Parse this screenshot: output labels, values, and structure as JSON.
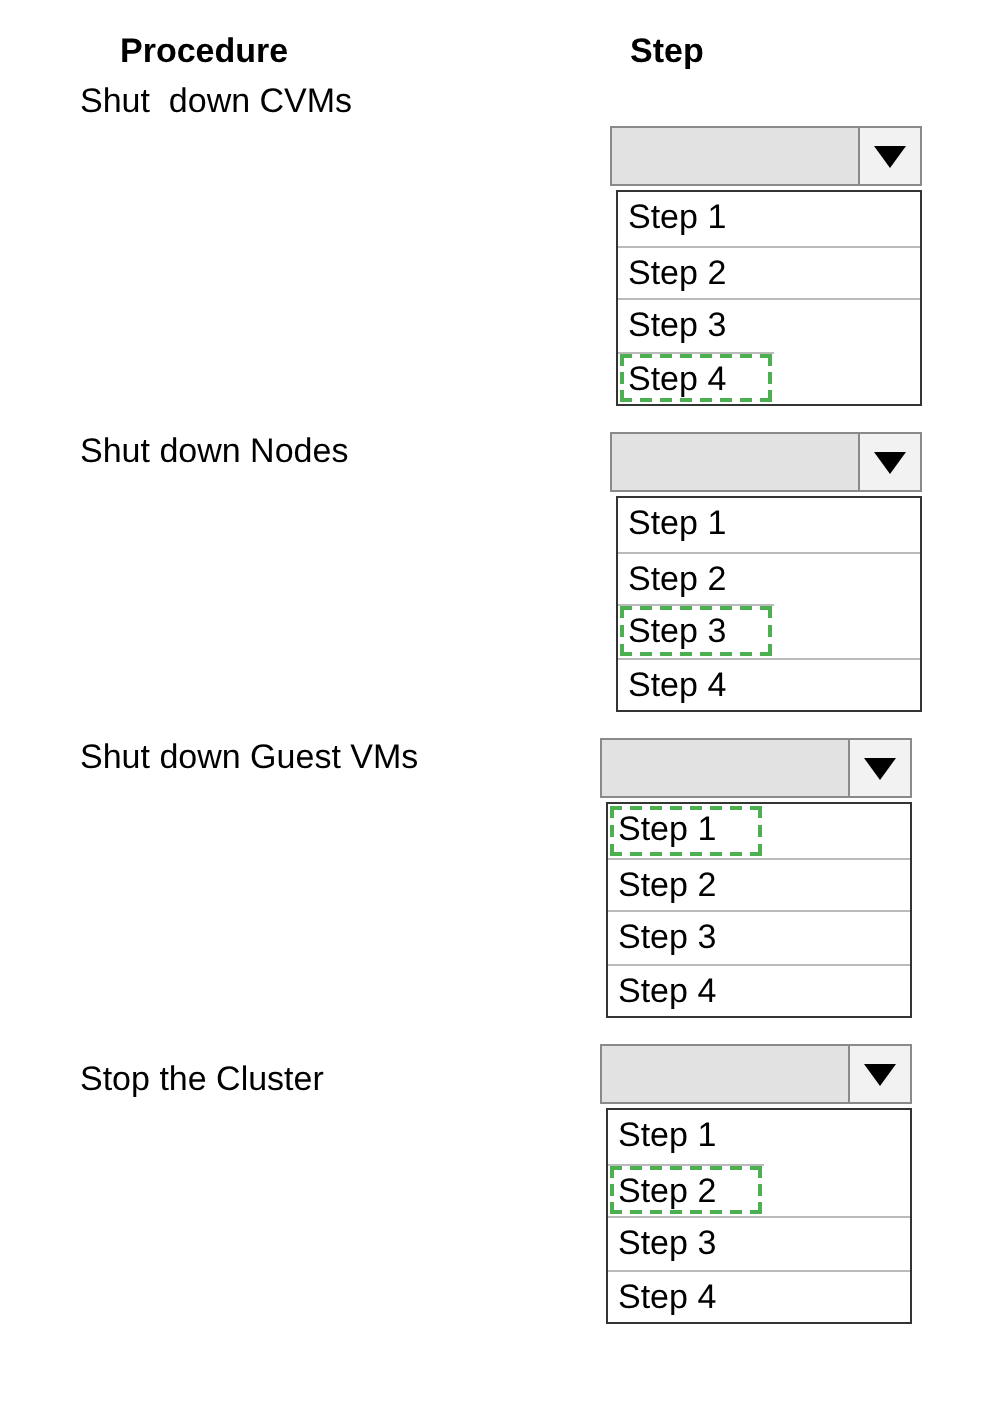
{
  "headers": {
    "procedure": "Procedure",
    "step": "Step"
  },
  "procedures": [
    {
      "label": "Shut  down CVMs",
      "options": [
        {
          "label": "Step 1",
          "selected": false
        },
        {
          "label": "Step 2",
          "selected": false
        },
        {
          "label": "Step 3",
          "selected": false
        },
        {
          "label": "Step 4",
          "selected": true
        }
      ]
    },
    {
      "label": "Shut down Nodes",
      "options": [
        {
          "label": "Step 1",
          "selected": false
        },
        {
          "label": "Step 2",
          "selected": false
        },
        {
          "label": "Step 3",
          "selected": true
        },
        {
          "label": "Step 4",
          "selected": false
        }
      ]
    },
    {
      "label": "Shut down Guest VMs",
      "options": [
        {
          "label": "Step 1",
          "selected": true
        },
        {
          "label": "Step 2",
          "selected": false
        },
        {
          "label": "Step 3",
          "selected": false
        },
        {
          "label": "Step 4",
          "selected": false
        }
      ]
    },
    {
      "label": "Stop the Cluster",
      "options": [
        {
          "label": "Step 1",
          "selected": false
        },
        {
          "label": "Step 2",
          "selected": true
        },
        {
          "label": "Step 3",
          "selected": false
        },
        {
          "label": "Step 4",
          "selected": false
        }
      ]
    }
  ]
}
